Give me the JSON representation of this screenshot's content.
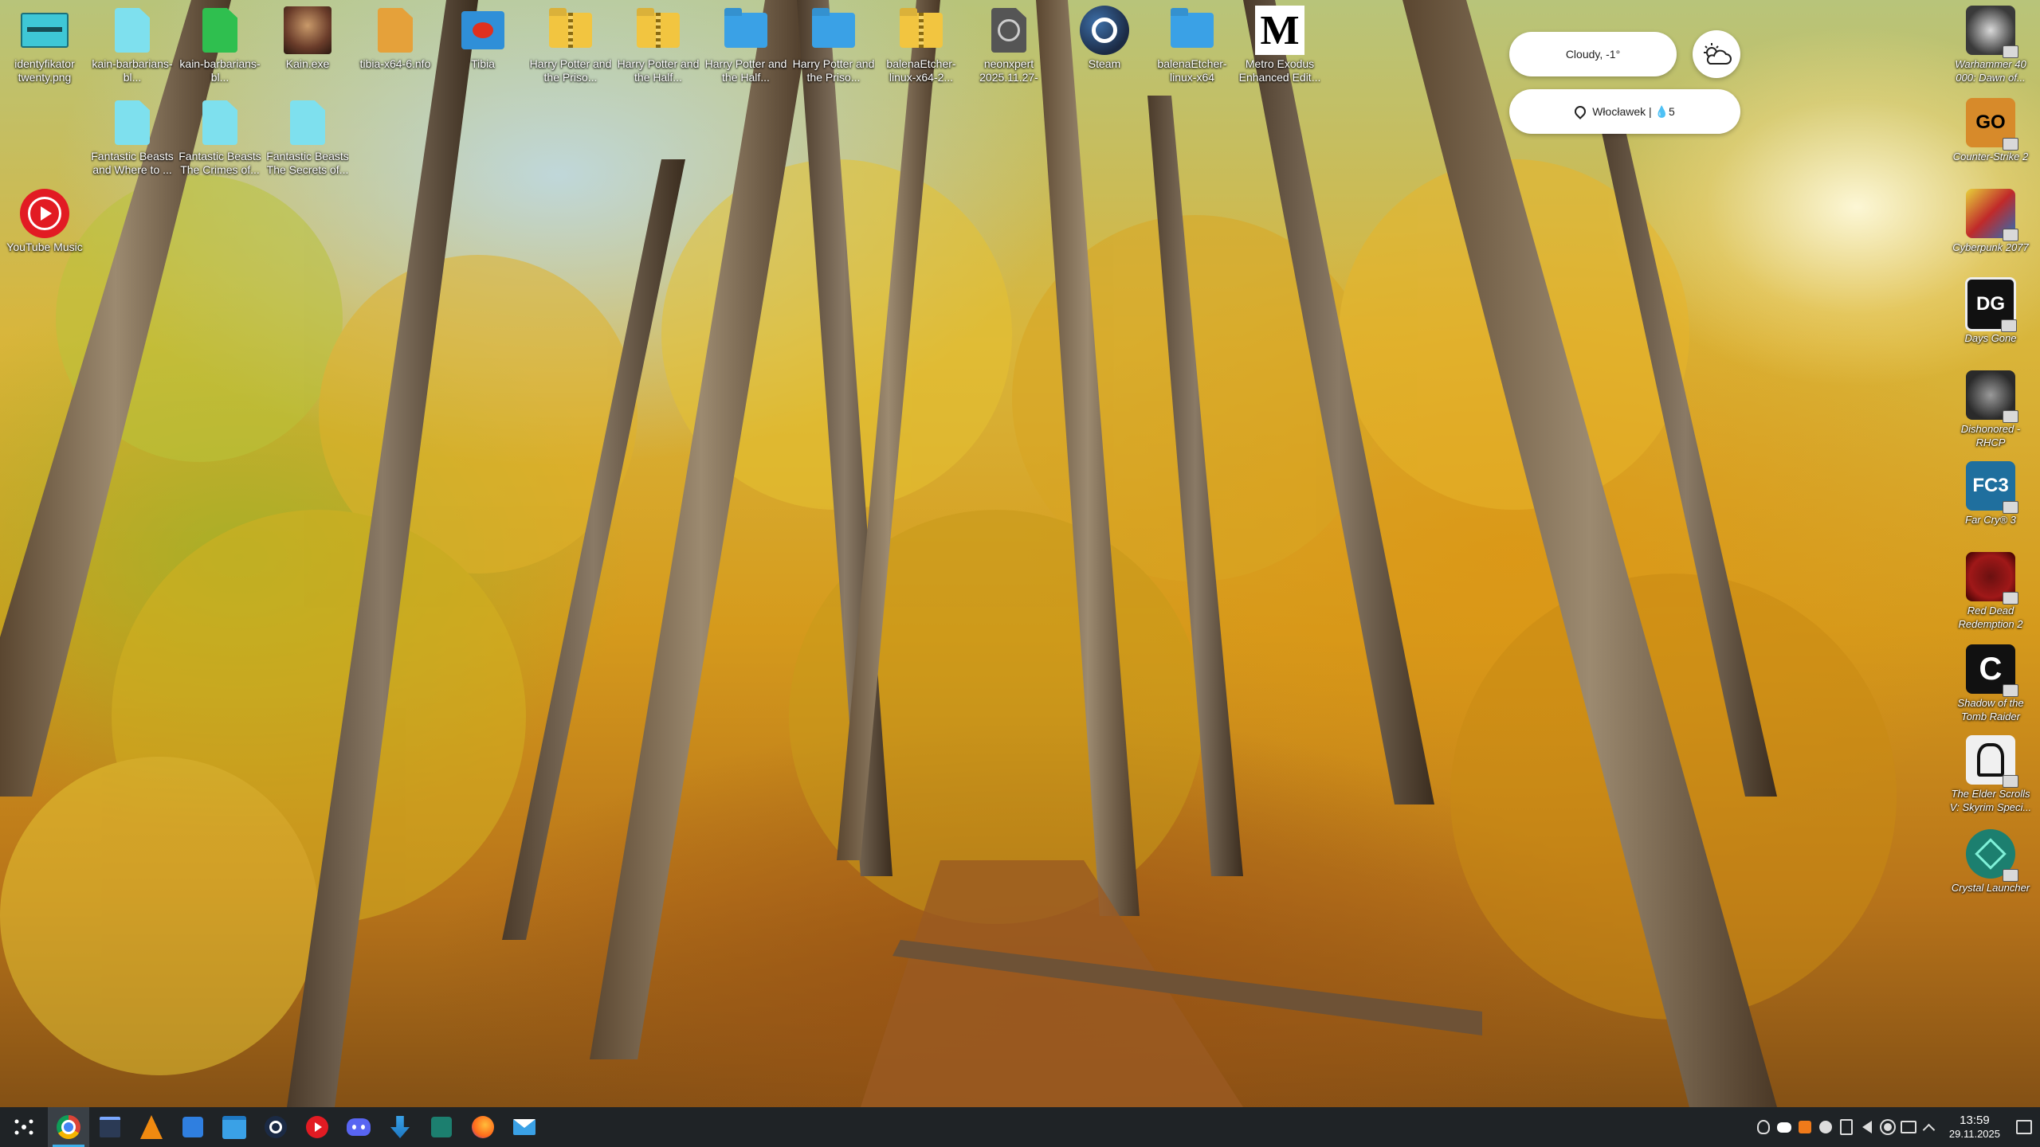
{
  "desktop": {
    "left_icons": [
      {
        "label": "identyfikator twenty.png",
        "icon": "image-file-icon",
        "color": "#3ec7d6"
      },
      {
        "label": "kain-barbarians-bl...",
        "icon": "document-file-icon",
        "color": "#7ee0ee"
      },
      {
        "label": "kain-barbarians-bl...",
        "icon": "archive-file-icon",
        "color": "#2fbf4f"
      },
      {
        "label": "Kain.exe",
        "icon": "kain-portrait-icon",
        "color": "#6a3c2a"
      },
      {
        "label": "tibia-x64-6.nfo",
        "icon": "archive-file-icon",
        "color": "#e5a13a"
      },
      {
        "label": "Tibia",
        "icon": "tibia-game-icon",
        "color": "#2f8fd8"
      },
      {
        "label": "Harry Potter and the Priso...",
        "icon": "zip-folder-icon",
        "color": "#f2c540"
      },
      {
        "label": "Harry Potter and the Half...",
        "icon": "zip-folder-icon",
        "color": "#f2c540"
      },
      {
        "label": "Harry Potter and the Half...",
        "icon": "folder-icon",
        "color": "#3aa1e6"
      },
      {
        "label": "Harry Potter and the Priso...",
        "icon": "folder-icon",
        "color": "#3aa1e6"
      },
      {
        "label": "balenaEtcher-linux-x64-2...",
        "icon": "zip-folder-icon",
        "color": "#f2c540"
      },
      {
        "label": "neonxpert 2025.11.27-074...",
        "icon": "disk-image-icon",
        "color": "#555555"
      },
      {
        "label": "Steam",
        "icon": "steam-icon",
        "color": "#1b2a44"
      },
      {
        "label": "balenaEtcher-linux-x64",
        "icon": "folder-icon",
        "color": "#3aa1e6"
      },
      {
        "label": "Metro Exodus Enhanced Edit...",
        "icon": "metro-icon",
        "color": "#000000"
      }
    ],
    "second_row_icons": [
      {
        "label": "Fantastic Beasts and Where to ...",
        "icon": "video-file-icon",
        "color": "#7ee0ee"
      },
      {
        "label": "Fantastic Beasts The Crimes of...",
        "icon": "video-file-icon",
        "color": "#7ee0ee"
      },
      {
        "label": "Fantastic Beasts The Secrets of...",
        "icon": "video-file-icon",
        "color": "#7ee0ee"
      }
    ],
    "youtube_music": {
      "label": "YouTube Music",
      "icon": "youtube-music-icon",
      "color": "#e21b23"
    },
    "right_icons": [
      {
        "label": "Warhammer 40 000: Dawn of...",
        "icon": "warhammer-icon",
        "tile_text": "",
        "color": "#3a3a3a"
      },
      {
        "label": "Counter-Strike 2",
        "icon": "counter-strike-icon",
        "tile_text": "GO",
        "color": "#d78a2a"
      },
      {
        "label": "Cyberpunk 2077",
        "icon": "cyberpunk-icon",
        "tile_text": "",
        "color": "#c02a2a"
      },
      {
        "label": "Days Gone",
        "icon": "days-gone-icon",
        "tile_text": "DG",
        "color": "#111111"
      },
      {
        "label": "Dishonored - RHCP",
        "icon": "dishonored-icon",
        "tile_text": "",
        "color": "#2a2a2a"
      },
      {
        "label": "Far Cry® 3",
        "icon": "far-cry-3-icon",
        "tile_text": "FC3",
        "color": "#1f6f9e"
      },
      {
        "label": "Red Dead Redemption 2",
        "icon": "red-dead-icon",
        "tile_text": "",
        "color": "#a01818"
      },
      {
        "label": "Shadow of the Tomb Raider",
        "icon": "tomb-raider-icon",
        "tile_text": "C",
        "color": "#111111"
      },
      {
        "label": "The Elder Scrolls V: Skyrim Speci...",
        "icon": "skyrim-icon",
        "tile_text": "",
        "color": "#f0f0f0"
      },
      {
        "label": "Crystal Launcher",
        "icon": "crystal-launcher-icon",
        "tile_text": "",
        "color": "#1c7f6f"
      }
    ]
  },
  "weather": {
    "condition": "Cloudy, -1°",
    "location": "Włocławek | 💧5",
    "icon": "cloudy-sun-icon"
  },
  "taskbar": {
    "launcher_icon": "application-launcher-icon",
    "apps": [
      {
        "name": "Google Chrome",
        "icon": "chrome-icon",
        "active": true
      },
      {
        "name": "Task manager",
        "icon": "window-list-icon",
        "active": false
      },
      {
        "name": "VLC",
        "icon": "vlc-icon",
        "active": false
      },
      {
        "name": "Software store",
        "icon": "store-icon",
        "active": false
      },
      {
        "name": "Files",
        "icon": "file-manager-icon",
        "active": false
      },
      {
        "name": "Steam",
        "icon": "steam-icon",
        "active": false
      },
      {
        "name": "YouTube Music",
        "icon": "youtube-music-icon",
        "active": false
      },
      {
        "name": "Discord",
        "icon": "discord-icon",
        "active": false
      },
      {
        "name": "Downloader",
        "icon": "download-icon",
        "active": false
      },
      {
        "name": "Crystal Launcher",
        "icon": "crystal-launcher-icon",
        "active": false
      },
      {
        "name": "Firefox",
        "icon": "firefox-icon",
        "active": false
      },
      {
        "name": "Mail",
        "icon": "mail-icon",
        "active": false
      }
    ],
    "tray": [
      "bug-icon",
      "discord-tray-icon",
      "orange-app-icon",
      "steam-tray-icon",
      "clipboard-icon",
      "volume-icon",
      "brightness-icon",
      "display-icon",
      "chevron-up-icon"
    ],
    "time": "13:59",
    "date": "29.11.2025",
    "show_desktop_icon": "show-desktop-icon"
  }
}
